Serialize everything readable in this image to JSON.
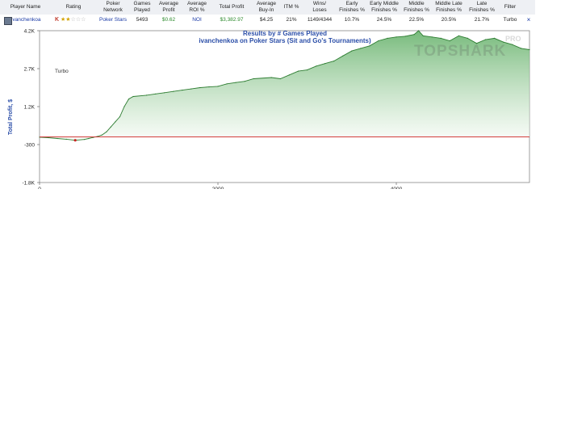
{
  "table": {
    "headers": [
      "Player Name",
      "Rating",
      "Poker\nNetwork",
      "Games\nPlayed",
      "Average\nProfit",
      "Average\nROI %",
      "Total Profit",
      "Average\nBuy-In",
      "ITM %",
      "Wins/\nLoses",
      "Early\nFinishes %",
      "Early Middle\nFinishes %",
      "Middle\nFinishes %",
      "Middle Late\nFinishes %",
      "Late\nFinishes %",
      "Filter"
    ],
    "row": {
      "player_name": "ivanchenkoa",
      "rating_letter": "K",
      "rating_stars_filled": 2,
      "rating_stars_total": 5,
      "poker_network": "Poker Stars",
      "games_played": "5493",
      "average_profit": "$0.62",
      "average_roi": "NOI",
      "total_profit": "$3,382.97",
      "average_buyin": "$4.25",
      "itm": "21%",
      "wins_loses": "1149/4344",
      "early_finishes": "10.7%",
      "early_middle_finishes": "24.5%",
      "middle_finishes": "22.5%",
      "middle_late_finishes": "20.5%",
      "late_finishes": "21.7%",
      "filter": "Turbo",
      "close_label": "×"
    }
  },
  "chart_data": {
    "type": "area",
    "title": "Results by # Games Played",
    "subtitle": "ivanchenkoa on Poker Stars (Sit and Go's Tournaments)",
    "ylabel": "Total Profit, $",
    "xlabel": "",
    "annotation": "Turbo",
    "watermark": "TOPSHARK",
    "watermark_badge": "PRO",
    "ylim": [
      -1800,
      4200
    ],
    "xlim": [
      0,
      5493
    ],
    "yticks": [
      -1800,
      -300,
      1200,
      2700,
      4200
    ],
    "ytick_labels": [
      "-1.8K",
      "-300",
      "1.2K",
      "2.7K",
      "4.2K"
    ],
    "xticks": [
      0,
      2000,
      4000
    ],
    "xtick_labels": [
      "0",
      "2000",
      "4000"
    ],
    "zero_line": 0,
    "grid": "none",
    "colors": {
      "line": "#2e7d32",
      "fill_top": "#5fae64",
      "fill_bottom": "#f4faf3",
      "zero": "#cc2222",
      "title": "#2b4ea8",
      "axis_label": "#2b4ea8"
    },
    "series": [
      {
        "x": [
          0,
          100,
          200,
          300,
          400,
          500,
          550,
          600,
          650,
          700,
          750,
          800,
          850,
          900,
          950,
          1000,
          1050,
          1200,
          1300,
          1400,
          1500,
          1600,
          1700,
          1800,
          1900,
          2000,
          2100,
          2200,
          2300,
          2400,
          2600,
          2700,
          2800,
          2900,
          3000,
          3100,
          3200,
          3300,
          3400,
          3500,
          3600,
          3700,
          3800,
          3900,
          4000,
          4100,
          4200,
          4250,
          4300,
          4400,
          4500,
          4600,
          4700,
          4800,
          4900,
          5000,
          5100,
          5200,
          5300,
          5400,
          5493
        ],
        "y": [
          -10,
          -30,
          -60,
          -90,
          -130,
          -100,
          -60,
          -20,
          20,
          80,
          200,
          400,
          600,
          800,
          1200,
          1500,
          1600,
          1650,
          1700,
          1750,
          1800,
          1850,
          1900,
          1950,
          1980,
          2000,
          2100,
          2150,
          2200,
          2300,
          2350,
          2300,
          2450,
          2600,
          2650,
          2800,
          2900,
          3000,
          3200,
          3400,
          3500,
          3600,
          3800,
          3900,
          3950,
          3980,
          4050,
          4200,
          4000,
          3950,
          3900,
          3800,
          4000,
          3900,
          3700,
          3850,
          3900,
          3750,
          3650,
          3500,
          3450
        ]
      }
    ]
  }
}
